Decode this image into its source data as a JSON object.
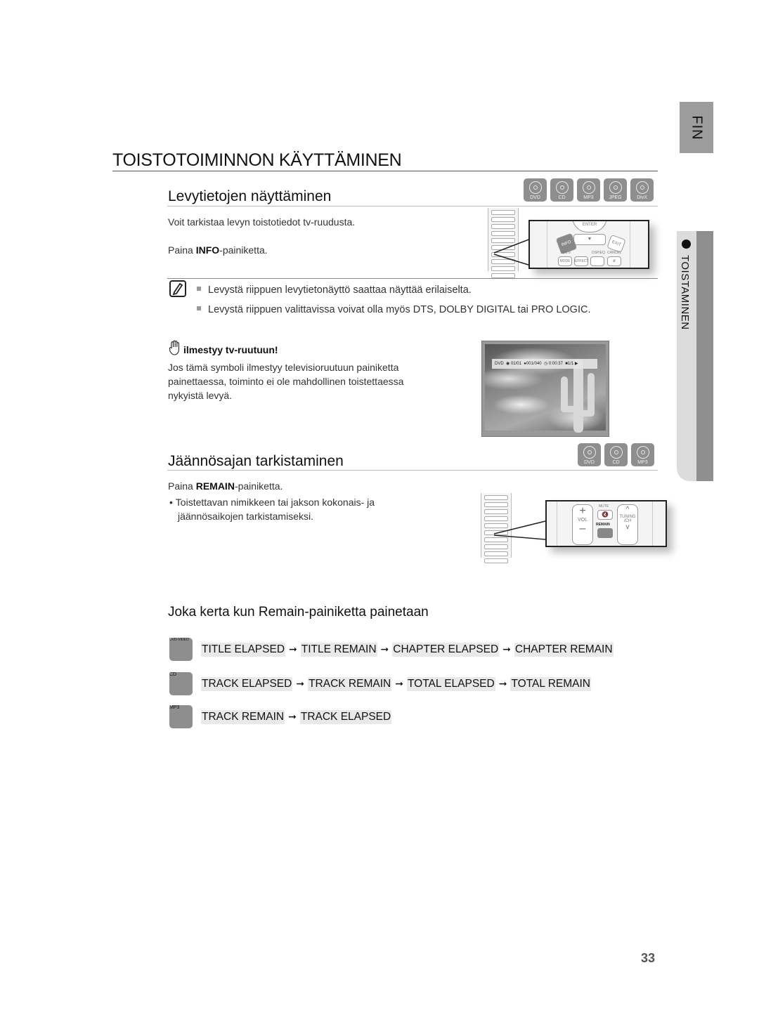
{
  "side_tabs": {
    "language": "FIN",
    "chapter": "TOISTAMINEN"
  },
  "page_title": "TOISTOTOIMINNON KÄYTTÄMINEN",
  "section_disc_info": {
    "title": "Levytietojen näyttäminen",
    "badges": [
      "DVD",
      "CD",
      "MP3",
      "JPEG",
      "DivX"
    ],
    "intro": "Voit tarkistaa levyn toistotiedot tv-ruudusta.",
    "instruction_prefix": "Paina ",
    "instruction_key": "INFO",
    "instruction_suffix": "-painiketta.",
    "remote_labels": {
      "enter": "ENTER",
      "info": "INFO",
      "exit": "EXIT",
      "dsp": "DSP/EQ",
      "cancel": "CANCEL",
      "mode": "MODE",
      "effect": "EFFECT",
      "dpl": "DPL II"
    },
    "notes": [
      "Levystä riippuen levytietonäyttö saattaa näyttää erilaiselta.",
      "Levystä riippuen valittavissa voivat olla myös DTS, DOLBY DIGITAL tai PRO LOGIC."
    ],
    "hand_heading": "ilmestyy tv-ruutuun!",
    "hand_text": "Jos tämä symboli ilmestyy televisioruutuun painiketta painettaessa, toiminto ei ole mahdollinen toistettaessa nykyistä levyä.",
    "osd": {
      "disc": "DVD",
      "title": "01/01",
      "chapter": "001/040",
      "time": "0:00:37",
      "angle": "1/1"
    }
  },
  "section_remain": {
    "title": "Jäännösajan tarkistaminen",
    "badges": [
      "DVD",
      "CD",
      "MP3"
    ],
    "instruction_prefix": "Paina ",
    "instruction_key": "REMAIN",
    "instruction_suffix": "-painiketta.",
    "bullet": "Toistettavan nimikkeen tai jakson kokonais- ja jäännösaikojen tarkistamiseksi.",
    "remote_labels": {
      "mute": "MUTE",
      "vol": "VOL",
      "remain": "REMAIN",
      "tuning": "TUNING",
      "ch": "/CH"
    }
  },
  "section_sequence": {
    "title": "Joka kerta kun Remain-painiketta painetaan",
    "rows": [
      {
        "badge": "DVD-VIDEO",
        "steps": [
          "TITLE ELAPSED",
          "TITLE REMAIN",
          "CHAPTER ELAPSED",
          "CHAPTER REMAIN"
        ]
      },
      {
        "badge": "CD",
        "steps": [
          "TRACK ELAPSED",
          "TRACK REMAIN",
          "TOTAL ELAPSED",
          "TOTAL REMAIN"
        ]
      },
      {
        "badge": "MP3",
        "steps": [
          "TRACK REMAIN",
          "TRACK ELAPSED"
        ]
      }
    ],
    "arrow": "➞"
  },
  "page_number": "33"
}
